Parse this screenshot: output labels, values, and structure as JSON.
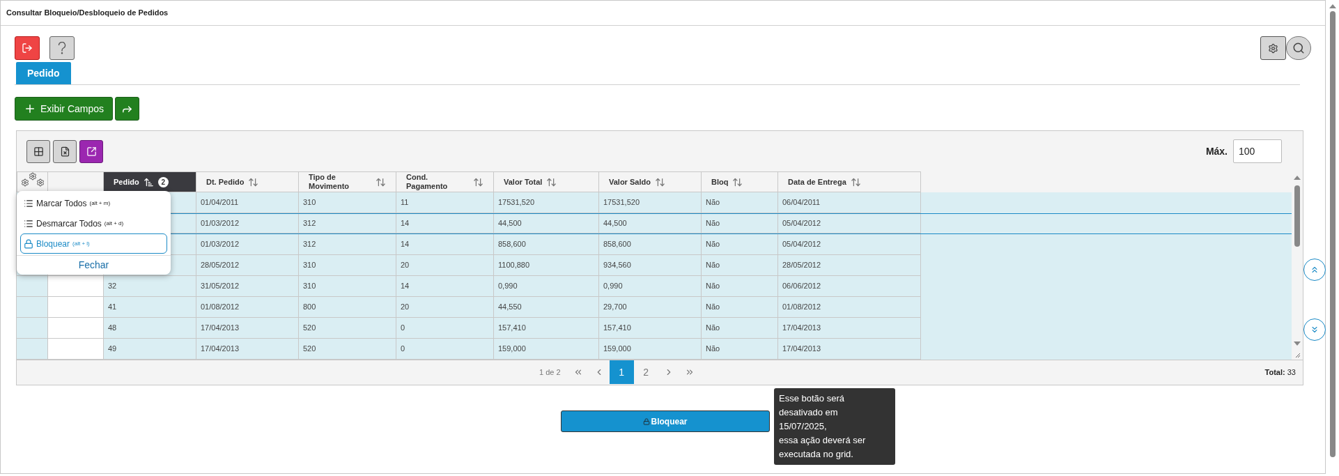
{
  "window": {
    "title": "Consultar Bloqueio/Desbloqueio de Pedidos"
  },
  "tabs": [
    {
      "label": "Pedido",
      "selected": true
    }
  ],
  "actions": {
    "show_fields": "Exibir Campos"
  },
  "grid": {
    "max_label": "Máx.",
    "max_value": "100",
    "columns": [
      {
        "label": "Pedido",
        "sorted": true,
        "sort_badge": "2"
      },
      {
        "label": "Dt. Pedido",
        "sorted": false
      },
      {
        "label": "Tipo de Movimento",
        "sorted": false
      },
      {
        "label": "Cond. Pagamento",
        "sorted": false
      },
      {
        "label": "Valor Total",
        "sorted": false
      },
      {
        "label": "Valor Saldo",
        "sorted": false
      },
      {
        "label": "Bloq",
        "sorted": false
      },
      {
        "label": "Data de Entrega",
        "sorted": false
      }
    ],
    "rows": [
      {
        "selected": false,
        "cells": [
          "",
          "01/04/2011",
          "310",
          "11",
          "17531,520",
          "17531,520",
          "Não",
          "06/04/2011"
        ]
      },
      {
        "selected": true,
        "cells": [
          "",
          "01/03/2012",
          "312",
          "14",
          "44,500",
          "44,500",
          "Não",
          "05/04/2012"
        ]
      },
      {
        "selected": false,
        "cells": [
          "",
          "01/03/2012",
          "312",
          "14",
          "858,600",
          "858,600",
          "Não",
          "05/04/2012"
        ]
      },
      {
        "selected": false,
        "cells": [
          "",
          "28/05/2012",
          "310",
          "20",
          "1100,880",
          "934,560",
          "Não",
          "28/05/2012"
        ]
      },
      {
        "selected": false,
        "cells": [
          "32",
          "31/05/2012",
          "310",
          "14",
          "0,990",
          "0,990",
          "Não",
          "06/06/2012"
        ]
      },
      {
        "selected": false,
        "cells": [
          "41",
          "01/08/2012",
          "800",
          "20",
          "44,550",
          "29,700",
          "Não",
          "01/08/2012"
        ]
      },
      {
        "selected": false,
        "cells": [
          "48",
          "17/04/2013",
          "520",
          "0",
          "157,410",
          "157,410",
          "Não",
          "17/04/2013"
        ]
      },
      {
        "selected": false,
        "cells": [
          "49",
          "17/04/2013",
          "520",
          "0",
          "159,000",
          "159,000",
          "Não",
          "17/04/2013"
        ]
      }
    ],
    "pagination": {
      "summary": "1 de 2",
      "pages": [
        {
          "label": "1",
          "selected": true
        },
        {
          "label": "2",
          "selected": false
        }
      ],
      "total_label": "Total:",
      "total": "33"
    }
  },
  "context_menu": {
    "items": [
      {
        "label": "Marcar Todos",
        "shortcut": "(alt + m)",
        "kind": "list",
        "selected": false
      },
      {
        "label": "Desmarcar Todos",
        "shortcut": "(alt + d)",
        "kind": "list",
        "selected": false
      },
      {
        "label": "Bloquear",
        "shortcut": "(alt + l)",
        "kind": "lock",
        "selected": true
      }
    ],
    "close": "Fechar"
  },
  "bottom_button": {
    "label": "Bloquear"
  },
  "tooltip": {
    "lines": [
      "Esse botão será",
      "desativado em",
      "15/07/2025,",
      "essa ação deverá ser",
      "executada no grid."
    ]
  }
}
